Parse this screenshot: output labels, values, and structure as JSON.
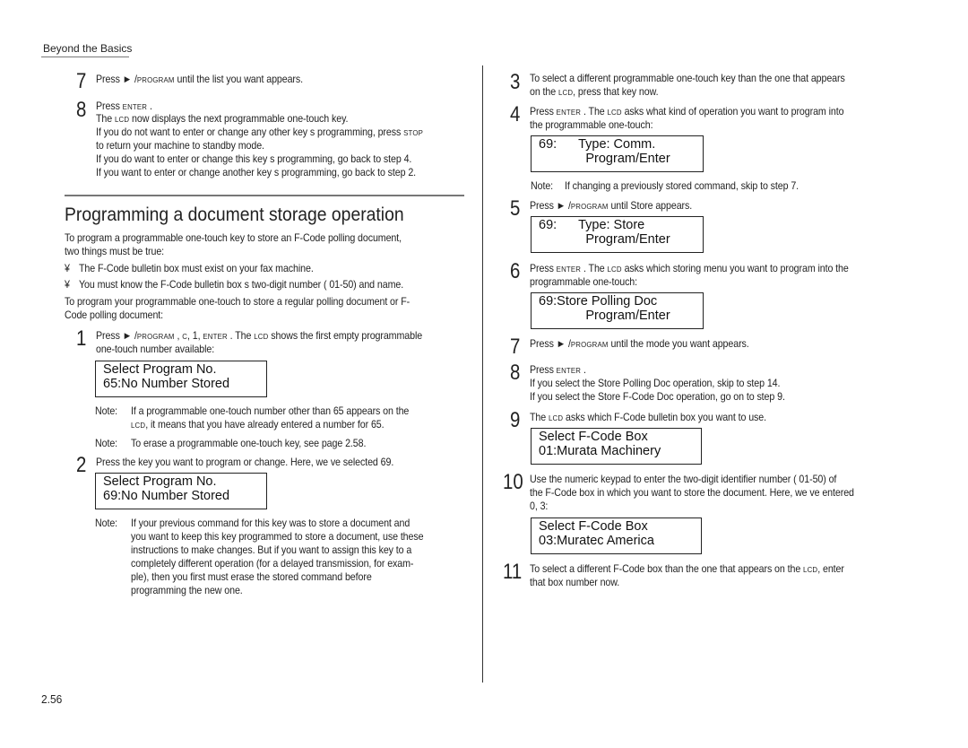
{
  "header": {
    "section": "Beyond the Basics"
  },
  "page_number": "2.56",
  "left_column": {
    "top_steps": [
      {
        "num": "7",
        "lines": [
          "Press ► /PROGRAM   until the list you want appears."
        ]
      },
      {
        "num": "8",
        "lines": [
          "Press ENTER .",
          "The LCD now displays the next programmable one-touch key.",
          "If you  do not want to enter or change   any other  key s programming, press   STOP",
          "to return your machine to standby mode.",
          "If you  do want to enter or change this key s programming, go back to step 4.",
          "If you want to enter or change    another  key s programming, go back to step 2."
        ]
      }
    ],
    "heading": "Programming a document storage operation",
    "intro": [
      "To program a programmable one-touch key to store an F-Code polling document,",
      "two things must be true:"
    ],
    "bullets": [
      "The F-Code bulletin box must exist on your fax machine.",
      "You must know the F-Code bulletin box s two-digit number (     01-50) and name."
    ],
    "bullet_glyph": "¥",
    "intro2": [
      "To program your programmable one-touch to store a regular polling document or F-",
      "Code polling document:"
    ],
    "step1": {
      "num": "1",
      "lines": [
        "Press ► /PROGRAM  , C, 1, ENTER  . The LCD shows the first empty programmable",
        "one-touch number available:"
      ],
      "lcd": [
        "Select Program No.",
        "65:No Number Stored"
      ]
    },
    "notes1": [
      {
        "label": "Note:",
        "lines": [
          "If a programmable one-touch number other than      65 appears on the",
          "LCD, it means that you have already entered a number for      65."
        ]
      },
      {
        "label": "Note:",
        "lines": [
          "To erase a programmable one-touch key, see page 2.58."
        ]
      }
    ],
    "step2": {
      "num": "2",
      "lines": [
        "Press the key you want to program or change. Here, we ve selected    69."
      ],
      "lcd": [
        "Select Program No.",
        "69:No Number Stored"
      ]
    },
    "note2": {
      "label": "Note:",
      "lines": [
        "If your previous command for this key was to store a document and",
        "you want to keep this key programmed to store a document, use these",
        "instructions to make changes. But if you want to assign this key to a",
        "completely different operation (for a delayed transmission, for exam-",
        "ple), then you first must erase the stored command before",
        "programming the new one."
      ]
    }
  },
  "right_column": {
    "step3": {
      "num": "3",
      "lines": [
        "To select a different programmable one-touch key than the one that appears",
        "on the LCD, press that key now."
      ]
    },
    "step4": {
      "num": "4",
      "lines": [
        "Press ENTER . The LCD asks what kind of operation you want to program into",
        "the programmable one-touch:"
      ],
      "lcd": [
        "69:      Type: Comm.",
        "             Program/Enter"
      ]
    },
    "note4": {
      "label": "Note:",
      "text": "If changing a previously stored command, skip to step 7."
    },
    "step5": {
      "num": "5",
      "lines": [
        "Press ► /PROGRAM   until    Store  appears."
      ],
      "lcd": [
        "69:      Type: Store",
        "             Program/Enter"
      ]
    },
    "step6": {
      "num": "6",
      "lines": [
        "Press ENTER . The LCD asks which storing menu you want to program into the",
        "programmable one-touch:"
      ],
      "lcd": [
        "69:Store Polling Doc",
        "             Program/Enter"
      ]
    },
    "step7": {
      "num": "7",
      "lines": [
        "Press ► /PROGRAM   until the mode you want appears."
      ]
    },
    "step8": {
      "num": "8",
      "lines": [
        "Press ENTER .",
        "If you select the    Store Polling Doc   operation, skip to step 14.",
        "If you select the    Store F-Code Doc  operation, go on to step 9."
      ]
    },
    "step9": {
      "num": "9",
      "lines": [
        "The LCD asks which F-Code bulletin box you want to use."
      ],
      "lcd": [
        "Select F-Code Box",
        "01:Murata Machinery"
      ]
    },
    "step10": {
      "num": "10",
      "lines": [
        "Use the numeric keypad to enter the two-digit identifier number (       01-50) of",
        "the F-Code box in which you want to store the document. Here, we ve entered",
        "0, 3:"
      ],
      "lcd": [
        "Select F-Code Box",
        "03:Muratec America"
      ]
    },
    "step11": {
      "num": "11",
      "lines": [
        "To select a different F-Code box than the one that appears on the     LCD, enter",
        "that box number now."
      ]
    }
  }
}
